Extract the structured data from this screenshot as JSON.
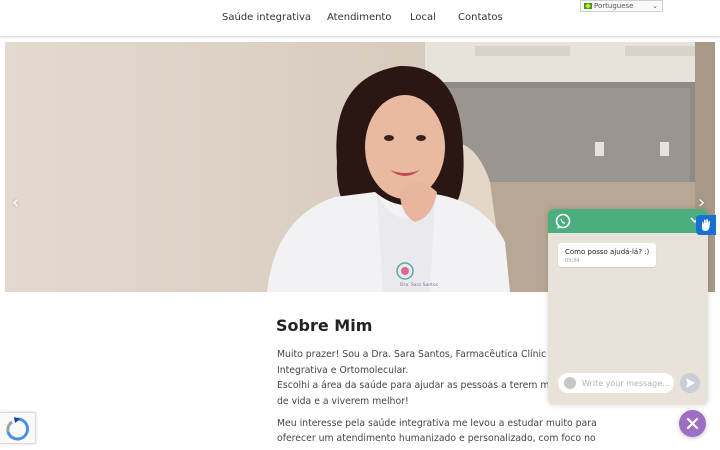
{
  "nav": {
    "items": [
      {
        "label": "Saúde integrativa"
      },
      {
        "label": "Atendimento"
      },
      {
        "label": "Local"
      },
      {
        "label": "Contatos"
      }
    ],
    "language": {
      "selected": "Portuguese"
    }
  },
  "slider": {
    "prev_symbol": "‹",
    "next_symbol": "›",
    "coat_logo": "Dra. Sara Santos",
    "active_slide": 1,
    "slide_count": 2
  },
  "about": {
    "title": "Sobre Mim",
    "p1_line1": "Muito prazer! Sou a Dra. Sara Santos, Farmacêutica Clínic",
    "p1_line2": "Integrativa e Ortomolecular.",
    "p1_line3": "Escolhi a área da saúde para ajudar as pessoas a terem ma",
    "p1_line4": "de vida e a viverem melhor!",
    "p2_line1": "Meu interesse pela saúde integrativa me levou a estudar muito para",
    "p2_line2": "oferecer um atendimento humanizado e personalizado, com foco no"
  },
  "chat": {
    "message": "Como posso ajudá-lá? :)",
    "time": "03:34",
    "input_placeholder": "Write your message..."
  },
  "colors": {
    "whatsapp_green": "#4aae7e",
    "fab_purple": "#9c6fc4",
    "accessibility_blue": "#1a6fd2"
  }
}
